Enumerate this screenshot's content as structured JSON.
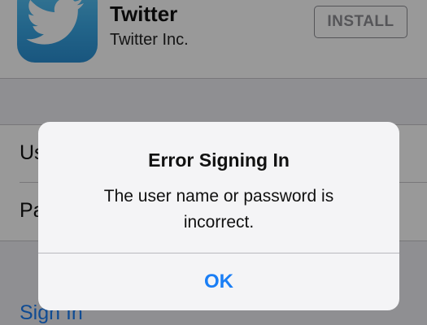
{
  "app": {
    "name": "Twitter",
    "developer": "Twitter Inc.",
    "install_label": "INSTALL",
    "icon": "twitter-bird-icon"
  },
  "form": {
    "username_label": "User Name",
    "password_label": "Password"
  },
  "sign_in_label": "Sign In",
  "alert": {
    "title": "Error Signing In",
    "message": "The user name or password is incorrect.",
    "ok_label": "OK"
  },
  "colors": {
    "accent": "#1a7ef5",
    "icon_blue": "#3aa8e6",
    "background": "#efeff4"
  }
}
